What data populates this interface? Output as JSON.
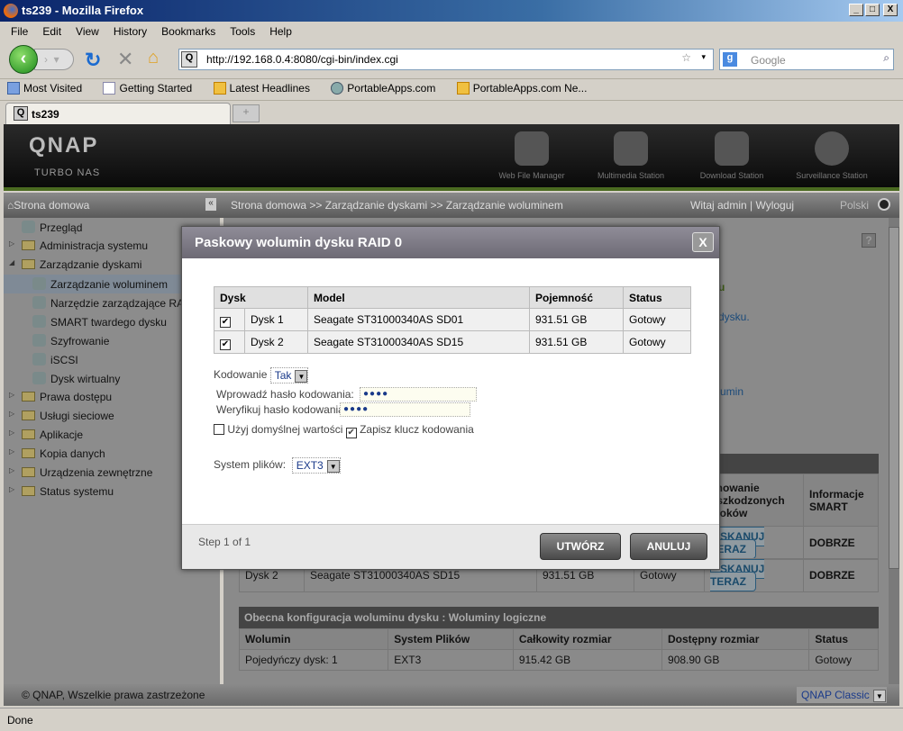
{
  "window": {
    "title": "ts239 - Mozilla Firefox",
    "controls": [
      "_",
      "□",
      "X"
    ]
  },
  "menu": [
    "File",
    "Edit",
    "View",
    "History",
    "Bookmarks",
    "Tools",
    "Help"
  ],
  "nav": {
    "url": "http://192.168.0.4:8080/cgi-bin/index.cgi",
    "search_placeholder": "Google"
  },
  "bookmarks": [
    "Most Visited",
    "Getting Started",
    "Latest Headlines",
    "PortableApps.com",
    "PortableApps.com Ne..."
  ],
  "tab": {
    "label": "ts239",
    "new_tab": "+"
  },
  "qnap": {
    "logo": "QNAP",
    "sub": "TURBO NAS",
    "apps": [
      "Web File Manager",
      "Multimedia Station",
      "Download Station",
      "Surveillance Station"
    ]
  },
  "bc": {
    "home": "Strona domowa",
    "path": "Strona domowa >> Zarządzanie dyskami >> Zarządzanie woluminem",
    "welcome": "Witaj admin | Wyloguj",
    "lang": "Polski"
  },
  "sidebar": [
    {
      "label": "Przegląd"
    },
    {
      "label": "Administracja systemu"
    },
    {
      "label": "Zarządzanie dyskami"
    },
    {
      "label": "Zarządzanie woluminem"
    },
    {
      "label": "Narzędzie zarządzające RAID"
    },
    {
      "label": "SMART twardego dysku"
    },
    {
      "label": "Szyfrowanie"
    },
    {
      "label": "iSCSI"
    },
    {
      "label": "Dysk wirtualny"
    },
    {
      "label": "Prawa dostępu"
    },
    {
      "label": "Usługi sieciowe"
    },
    {
      "label": "Aplikacje"
    },
    {
      "label": "Kopia danych"
    },
    {
      "label": "Urządzenia zewnętrzne"
    },
    {
      "label": "Status systemu"
    }
  ],
  "bg": {
    "frag1": "u",
    "frag2": "dysku.",
    "frag3": "umin",
    "disk_headers": [
      "anowanie\nuszkodzonych\nbloków",
      "Informacje SMART"
    ],
    "disk_rows": [
      {
        "disk": "Dysk 2",
        "model": "Seagate ST31000340AS SD15",
        "cap": "931.51 GB",
        "status": "Gotowy",
        "scan": "SKANUJ TERAZ",
        "smart": "DOBRZE"
      }
    ],
    "scan1": "SKANUJ TERAZ",
    "smart1": "DOBRZE",
    "lv_title": "Obecna konfiguracja woluminu dysku : Woluminy logiczne",
    "lv_headers": [
      "Wolumin",
      "System Plików",
      "Całkowity rozmiar",
      "Dostępny rozmiar",
      "Status"
    ],
    "lv_rows": [
      [
        "Pojedyńczy dysk: 1",
        "EXT3",
        "915.42 GB",
        "908.90 GB",
        "Gotowy"
      ]
    ]
  },
  "footer": {
    "copyright": "© QNAP, Wszelkie prawa zastrzeżone",
    "theme": "QNAP Classic"
  },
  "status": "Done",
  "dialog": {
    "title": "Paskowy wolumin dysku RAID 0",
    "close": "X",
    "headers": [
      "Dysk",
      "Model",
      "Pojemność",
      "Status"
    ],
    "rows": [
      {
        "checked": true,
        "disk": "Dysk 1",
        "model": "Seagate ST31000340AS SD01",
        "cap": "931.51 GB",
        "status": "Gotowy"
      },
      {
        "checked": true,
        "disk": "Dysk 2",
        "model": "Seagate ST31000340AS SD15",
        "cap": "931.51 GB",
        "status": "Gotowy"
      }
    ],
    "encrypt_label": "Kodowanie",
    "encrypt_value": "Tak",
    "pass_label": "Wprowadź hasło kodowania:",
    "pass_value": "●●●●",
    "verify_label": "Weryfikuj hasło kodowania:",
    "verify_value": "●●●●",
    "default_label": "Użyj domyślnej wartości",
    "default_checked": false,
    "save_key_label": "Zapisz klucz kodowania",
    "save_key_checked": true,
    "fs_label": "System plików:",
    "fs_value": "EXT3",
    "step": "Step 1 of 1",
    "create": "UTWÓRZ",
    "cancel": "ANULUJ"
  }
}
